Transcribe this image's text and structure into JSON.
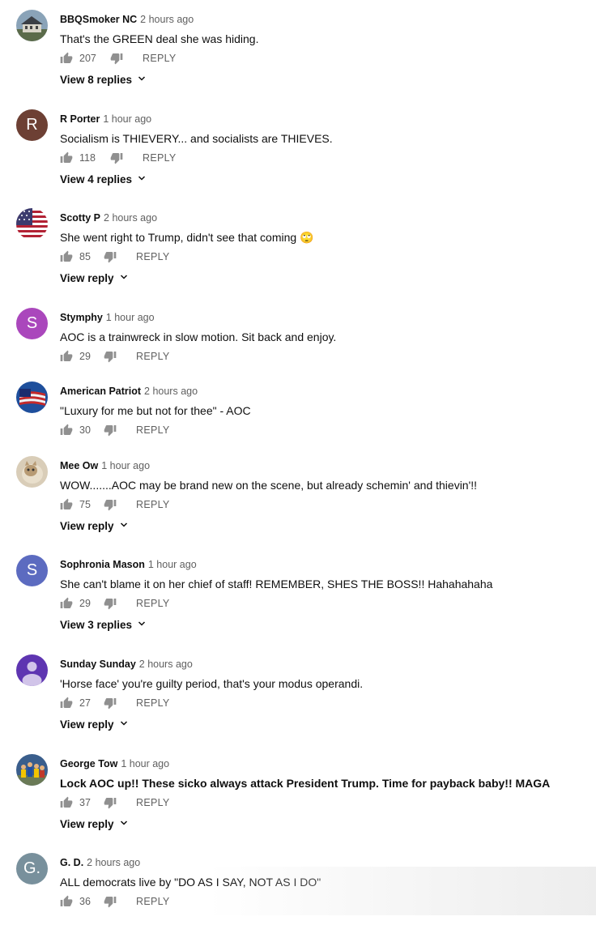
{
  "comments": [
    {
      "author": "BBQSmoker NC",
      "time": "2 hours ago",
      "text": "That's the GREEN deal she was hiding.",
      "likes": "207",
      "reply_label": "REPLY",
      "view_replies": "View 8 replies",
      "avatar": {
        "kind": "photo-house"
      }
    },
    {
      "author": "R Porter",
      "time": "1 hour ago",
      "text": "Socialism is THIEVERY... and socialists are THIEVES.",
      "likes": "118",
      "reply_label": "REPLY",
      "view_replies": "View 4 replies",
      "avatar": {
        "kind": "letter",
        "letter": "R",
        "color": "#6d4034"
      }
    },
    {
      "author": "Scotty P",
      "time": "2 hours ago",
      "text": "She went right to Trump, didn't see that coming 🙄",
      "likes": "85",
      "reply_label": "REPLY",
      "view_replies": "View reply",
      "avatar": {
        "kind": "flag"
      }
    },
    {
      "author": "Stymphy",
      "time": "1 hour ago",
      "text": "AOC is a trainwreck in slow motion. Sit back and enjoy.",
      "likes": "29",
      "reply_label": "REPLY",
      "view_replies": "",
      "avatar": {
        "kind": "letter",
        "letter": "S",
        "color": "#aa47bc"
      }
    },
    {
      "author": "American Patriot",
      "time": "2 hours ago",
      "text": "\"Luxury for me but not for thee\" - AOC",
      "likes": "30",
      "reply_label": "REPLY",
      "view_replies": "",
      "avatar": {
        "kind": "flag-wave"
      }
    },
    {
      "author": "Mee Ow",
      "time": "1 hour ago",
      "text": "WOW.......AOC may be brand new on the scene, but already schemin' and thievin'!!",
      "likes": "75",
      "reply_label": "REPLY",
      "view_replies": "View reply",
      "avatar": {
        "kind": "photo-cat"
      }
    },
    {
      "author": "Sophronia Mason",
      "time": "1 hour ago",
      "text": "She can't blame it on her chief of staff! REMEMBER, SHES THE BOSS!! Hahahahaha",
      "likes": "29",
      "reply_label": "REPLY",
      "view_replies": "View 3 replies",
      "avatar": {
        "kind": "letter",
        "letter": "S",
        "color": "#5c6bc0"
      }
    },
    {
      "author": "Sunday Sunday",
      "time": "2 hours ago",
      "text": "'Horse face' you're guilty period, that's your modus operandi.",
      "likes": "27",
      "reply_label": "REPLY",
      "view_replies": "View reply",
      "avatar": {
        "kind": "person"
      }
    },
    {
      "author": "George Tow",
      "time": "1 hour ago",
      "text": "Lock AOC up!! These sicko always attack President Trump. Time for payback baby!! MAGA",
      "likes": "37",
      "reply_label": "REPLY",
      "view_replies": "View reply",
      "avatar": {
        "kind": "photo-group"
      }
    },
    {
      "author": "G. D.",
      "time": "2 hours ago",
      "text": "ALL democrats live by \"DO AS I SAY, NOT AS I DO\"",
      "likes": "36",
      "reply_label": "REPLY",
      "view_replies": "",
      "avatar": {
        "kind": "letter",
        "letter": "G.",
        "color": "#78909c"
      }
    }
  ]
}
